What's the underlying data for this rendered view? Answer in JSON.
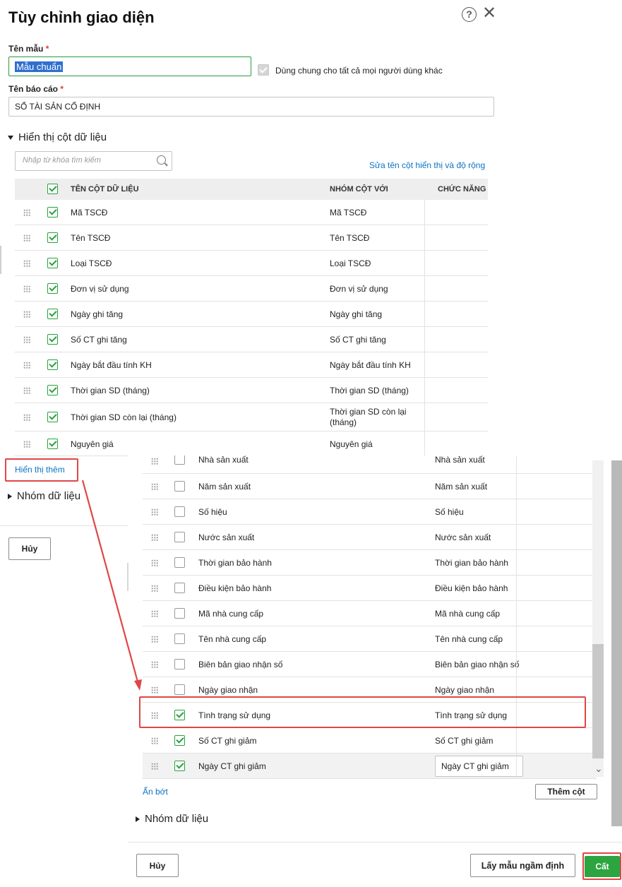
{
  "header": {
    "title": "Tùy chỉnh giao diện",
    "help_icon": "?",
    "close_icon": "✕"
  },
  "form": {
    "template_label": "Tên mẫu",
    "required_mark": "*",
    "template_value": "Mẫu chuẩn",
    "share_label": "Dùng chung cho tất cả mọi người dùng khác",
    "report_label": "Tên báo cáo",
    "report_value": "SỔ TÀI SẢN CỐ ĐỊNH"
  },
  "columns_section": {
    "title": "Hiển thị cột dữ liệu",
    "search_placeholder": "Nhập từ khóa tìm kiếm",
    "rename_link": "Sửa tên cột hiển thị và độ rộng",
    "headers": {
      "name": "TÊN CỘT DỮ LIỆU",
      "group": "NHÓM CỘT VỚI",
      "func": "CHỨC NĂNG"
    },
    "rows": [
      {
        "name": "Mã TSCĐ",
        "group": "Mã TSCĐ"
      },
      {
        "name": "Tên TSCĐ",
        "group": "Tên TSCĐ"
      },
      {
        "name": "Loại TSCĐ",
        "group": "Loại TSCĐ"
      },
      {
        "name": "Đơn vị sử dụng",
        "group": "Đơn vị sử dụng"
      },
      {
        "name": "Ngày ghi tăng",
        "group": "Ngày ghi tăng"
      },
      {
        "name": "Số CT ghi tăng",
        "group": "Số CT ghi tăng"
      },
      {
        "name": "Ngày bắt đầu tính KH",
        "group": "Ngày bắt đầu tính KH"
      },
      {
        "name": "Thời gian SD (tháng)",
        "group": "Thời gian SD (tháng)"
      },
      {
        "name": "Thời gian SD còn lại (tháng)",
        "group": "Thời gian SD còn lại (tháng)"
      },
      {
        "name": "Nguyên giá",
        "group": "Nguyên giá"
      }
    ],
    "show_more": "Hiển thị thêm"
  },
  "group_section": {
    "title": "Nhóm dữ liệu"
  },
  "left_cancel": "Hủy",
  "expanded": {
    "partial_row": "Nhà sản xuất",
    "rows": [
      {
        "name": "Năm sản xuất",
        "group": "Năm sản xuất",
        "checked": false
      },
      {
        "name": "Số hiệu",
        "group": "Số hiệu",
        "checked": false
      },
      {
        "name": "Nước sản xuất",
        "group": "Nước sản xuất",
        "checked": false
      },
      {
        "name": "Thời gian bảo hành",
        "group": "Thời gian bảo hành",
        "checked": false
      },
      {
        "name": "Điều kiện bảo hành",
        "group": "Điều kiện bảo hành",
        "checked": false
      },
      {
        "name": "Mã nhà cung cấp",
        "group": "Mã nhà cung cấp",
        "checked": false
      },
      {
        "name": "Tên nhà cung cấp",
        "group": "Tên nhà cung cấp",
        "checked": false
      },
      {
        "name": "Biên bản giao nhận số",
        "group": "Biên bản giao nhận số",
        "checked": false
      },
      {
        "name": "Ngày giao nhận",
        "group": "Ngày giao nhận",
        "checked": false
      },
      {
        "name": "Tình trạng sử dụng",
        "group": "Tình trạng sử dụng",
        "checked": true
      },
      {
        "name": "Số  CT ghi giảm",
        "group": "Số  CT ghi giảm",
        "checked": true
      },
      {
        "name": "Ngày CT ghi giảm",
        "group": "Ngày CT ghi giảm",
        "checked": true
      }
    ],
    "show_less": "Ẩn bớt",
    "add_column": "Thêm cột",
    "group_title": "Nhóm dữ liệu",
    "cancel": "Hủy",
    "default_template": "Lấy mẫu ngầm định",
    "save": "Cất"
  },
  "colors": {
    "accent_green": "#2ca43f",
    "link_blue": "#0b73c4",
    "highlight_red": "#e04646"
  }
}
